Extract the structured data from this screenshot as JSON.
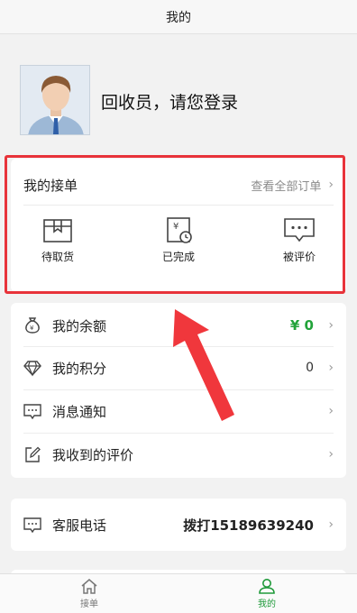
{
  "header": {
    "title": "我的"
  },
  "profile": {
    "name": "回收员，请您登录"
  },
  "orders": {
    "title": "我的接单",
    "view_all": "查看全部订单",
    "buttons": [
      {
        "label": "待取货",
        "icon": "pending-pickup-icon"
      },
      {
        "label": "已完成",
        "icon": "completed-icon"
      },
      {
        "label": "被评价",
        "icon": "rated-icon"
      }
    ]
  },
  "menu": [
    {
      "label": "我的余额",
      "value": "¥ 0",
      "icon": "money-bag-icon"
    },
    {
      "label": "我的积分",
      "value": "0",
      "icon": "diamond-icon"
    },
    {
      "label": "消息通知",
      "value": "",
      "icon": "message-icon"
    },
    {
      "label": "我收到的评价",
      "value": "",
      "icon": "edit-icon"
    }
  ],
  "service": {
    "label": "客服电话",
    "value": "拨打15189639240",
    "icon": "chat-icon"
  },
  "tabs": [
    {
      "label": "接单",
      "icon": "home-icon",
      "active": false
    },
    {
      "label": "我的",
      "icon": "user-icon",
      "active": true
    }
  ],
  "colors": {
    "accent": "#1f9a3a",
    "balance": "#22a33a",
    "highlight": "#e8333a"
  },
  "chevron": "›"
}
